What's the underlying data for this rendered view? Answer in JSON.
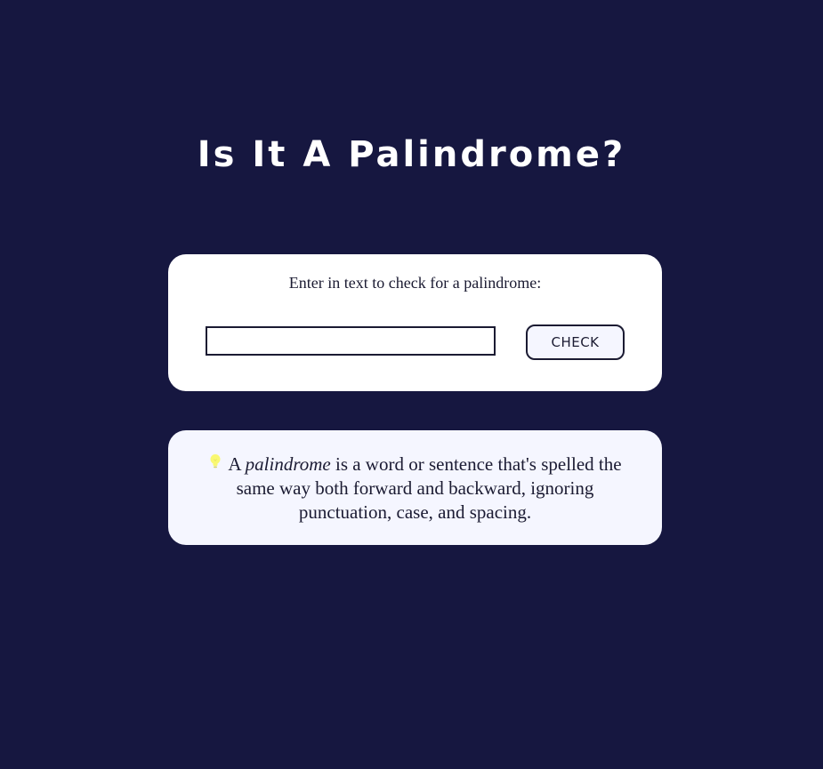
{
  "header": {
    "title": "Is It A Palindrome?"
  },
  "checker": {
    "label": "Enter in text to check for a palindrome:",
    "input_value": "",
    "input_placeholder": "",
    "button_label": "CHECK"
  },
  "info": {
    "icon": "lightbulb-icon",
    "prefix": "A ",
    "emphasis": "palindrome",
    "suffix": " is a word or sentence that's spelled the same way both forward and backward, ignoring punctuation, case, and spacing."
  },
  "colors": {
    "background": "#161740",
    "card": "#ffffff",
    "info_card": "#f5f6ff",
    "text": "#1b1b32",
    "bulb": "#f9f871"
  }
}
